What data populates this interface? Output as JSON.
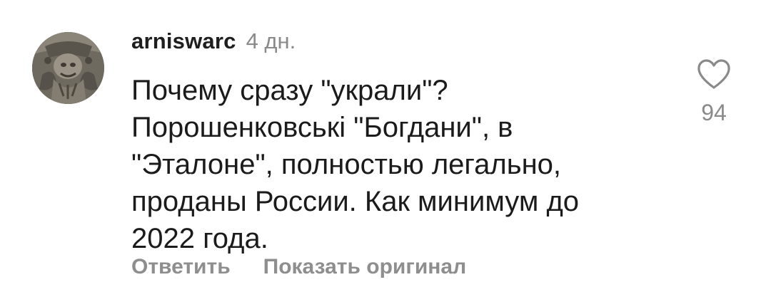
{
  "comment": {
    "username": "arniswarc",
    "time": "4 дн.",
    "text_lines": [
      "Почему сразу \"украли\"?",
      "Порошенковські \"Богдани\", в",
      "\"Эталоне\", полностью легально,",
      "проданы России. Как минимум до",
      "2022 года."
    ],
    "likes": "94",
    "actions": {
      "reply_label": "Ответить",
      "show_original_label": "Показать оригинал"
    },
    "icons": {
      "avatar": "avatar-photo",
      "like": "heart-outline-icon"
    },
    "colors": {
      "text": "#1b1b1b",
      "muted": "#8a8a8a"
    }
  }
}
